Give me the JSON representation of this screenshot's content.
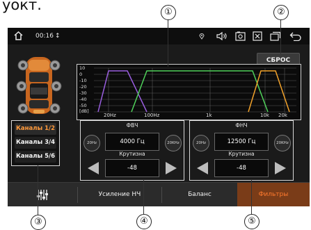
{
  "caption": "уокт.",
  "topbar": {
    "time": "00:16",
    "usb_glyph": "↕",
    "home_icon": "home-icon",
    "location_icon": "location-icon",
    "volume_icon": "volume-icon",
    "screenshot_icon": "screenshot-icon",
    "close_icon": "close-window-icon",
    "windows_icon": "windows-icon",
    "back_icon": "back-icon"
  },
  "reset_label": "СБРОС",
  "graph": {
    "y_ticks": [
      "10",
      "0",
      "-10",
      "-20",
      "-30",
      "-40",
      "-50"
    ],
    "y_unit": "[dB]",
    "x_ticks": [
      "20Hz",
      "100Hz",
      "1k",
      "10k",
      "20k"
    ]
  },
  "channels": [
    {
      "label": "Каналы 1/2",
      "active": true
    },
    {
      "label": "Каналы 3/4",
      "active": false
    },
    {
      "label": "Каналы 5/6",
      "active": false
    }
  ],
  "hpf": {
    "title": "ФВЧ",
    "min_label": "20Hz",
    "max_label": "20KHz",
    "value": "4000 Гц",
    "slope_title": "Крутизна",
    "slope_value": "-48"
  },
  "lpf": {
    "title": "ФНЧ",
    "min_label": "20Hz",
    "max_label": "20KHz",
    "value": "12500 Гц",
    "slope_title": "Крутизна",
    "slope_value": "-48"
  },
  "tabs": [
    {
      "label": "",
      "icon": "equalizer-icon",
      "active": false
    },
    {
      "label": "Усиление НЧ",
      "active": false
    },
    {
      "label": "Баланс",
      "active": false
    },
    {
      "label": "Фильтры",
      "active": true
    }
  ],
  "callouts": [
    "①",
    "②",
    "③",
    "④",
    "⑤"
  ],
  "colors": {
    "accent": "#ff7a2e",
    "curve_purple": "#9a5ee0",
    "curve_green": "#4fd15a",
    "curve_orange": "#f2a22b"
  }
}
